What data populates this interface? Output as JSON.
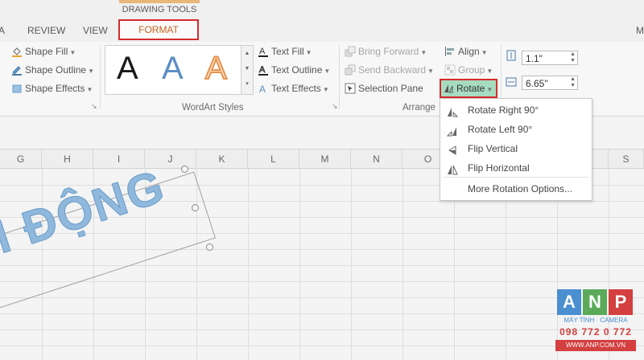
{
  "window": {
    "contextual_tab_group": "DRAWING TOOLS",
    "partial_right_tab": "M"
  },
  "tabs": [
    {
      "label": "A"
    },
    {
      "label": "REVIEW"
    },
    {
      "label": "VIEW"
    },
    {
      "label": "FORMAT",
      "active": true
    }
  ],
  "ribbon": {
    "shape_styles": {
      "fill": "Shape Fill",
      "outline": "Shape Outline",
      "effects": "Shape Effects"
    },
    "wordart_styles": {
      "group_label": "WordArt Styles",
      "samples": [
        {
          "letter": "A",
          "color": "#1a1a1a"
        },
        {
          "letter": "A",
          "color": "#5b8ec4"
        },
        {
          "letter": "A",
          "color": "#e8924a"
        }
      ],
      "text_fill": "Text Fill",
      "text_outline": "Text Outline",
      "text_effects": "Text Effects"
    },
    "arrange": {
      "group_label": "Arrange",
      "bring_forward": "Bring Forward",
      "send_backward": "Send Backward",
      "selection_pane": "Selection Pane",
      "align": "Align",
      "group": "Group",
      "rotate": "Rotate"
    },
    "size": {
      "height": "1.1\"",
      "width": "6.65\""
    }
  },
  "columns": [
    "G",
    "H",
    "I",
    "J",
    "K",
    "L",
    "M",
    "N",
    "O",
    "S"
  ],
  "wordart": {
    "text": "I ĐỘNG"
  },
  "rotate_menu": {
    "items": [
      {
        "label": "Rotate Right 90°",
        "icon": "rotate-right-icon"
      },
      {
        "label": "Rotate Left 90°",
        "icon": "rotate-left-icon"
      },
      {
        "label": "Flip Vertical",
        "icon": "flip-vertical-icon"
      },
      {
        "label": "Flip Horizontal",
        "icon": "flip-horizontal-icon"
      }
    ],
    "more": "More Rotation Options..."
  },
  "logo": {
    "letters": [
      "A",
      "N",
      "P"
    ],
    "tile_colors": [
      "#4a8fd0",
      "#5aaa5a",
      "#d43f3f"
    ],
    "tagline": "MÁY TÍNH · CAMERA",
    "phone": "098 772 0 772",
    "website": "WWW.ANP.COM.VN"
  }
}
